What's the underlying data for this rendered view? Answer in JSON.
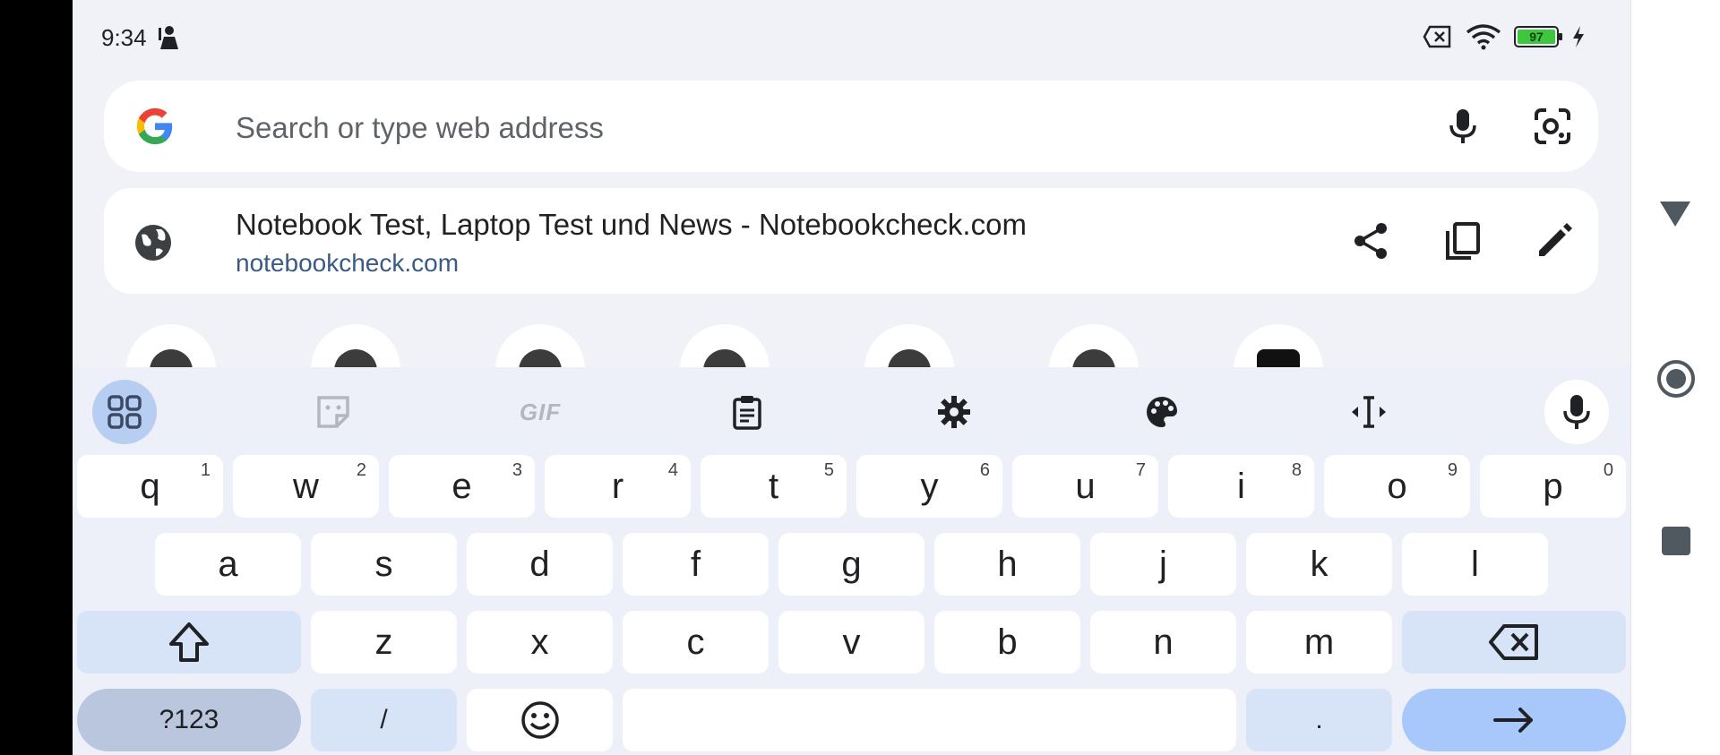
{
  "status_bar": {
    "time": "9:34",
    "battery": "97"
  },
  "omnibox": {
    "placeholder": "Search or type web address"
  },
  "suggestion": {
    "title": "Notebook Test, Laptop Test und News - Notebookcheck.com",
    "url": "notebookcheck.com"
  },
  "keyboard": {
    "toolbar": {
      "gif_label": "GIF"
    },
    "row1": [
      {
        "k": "q",
        "h": "1"
      },
      {
        "k": "w",
        "h": "2"
      },
      {
        "k": "e",
        "h": "3"
      },
      {
        "k": "r",
        "h": "4"
      },
      {
        "k": "t",
        "h": "5"
      },
      {
        "k": "y",
        "h": "6"
      },
      {
        "k": "u",
        "h": "7"
      },
      {
        "k": "i",
        "h": "8"
      },
      {
        "k": "o",
        "h": "9"
      },
      {
        "k": "p",
        "h": "0"
      }
    ],
    "row2": [
      "a",
      "s",
      "d",
      "f",
      "g",
      "h",
      "j",
      "k",
      "l"
    ],
    "row3": [
      "z",
      "x",
      "c",
      "v",
      "b",
      "n",
      "m"
    ],
    "symbols_label": "?123",
    "slash_label": "/",
    "dot_label": "."
  }
}
